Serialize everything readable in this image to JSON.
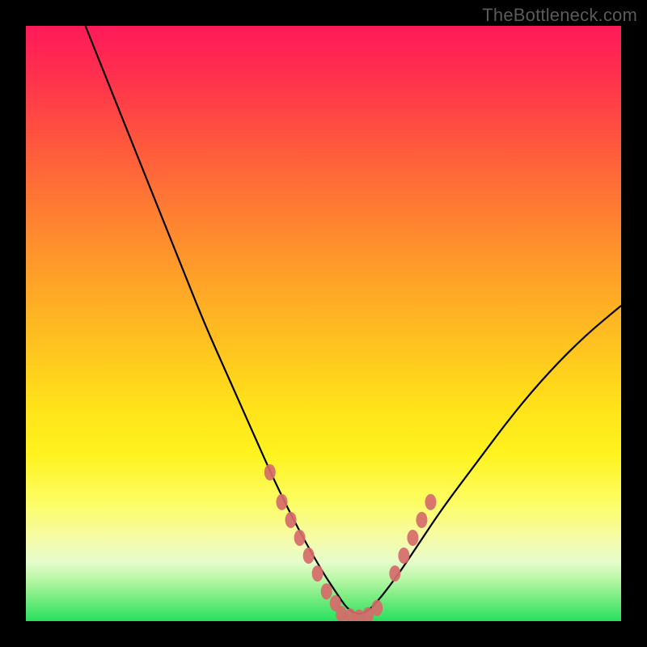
{
  "watermark": "TheBottleneck.com",
  "chart_data": {
    "type": "line",
    "title": "",
    "xlabel": "",
    "ylabel": "",
    "xlim": [
      0,
      100
    ],
    "ylim": [
      0,
      100
    ],
    "grid": false,
    "legend": false,
    "background_gradient": {
      "top": "#ff1a59",
      "mid": "#ffe21a",
      "bottom": "#28e05f"
    },
    "series": [
      {
        "name": "curve",
        "color": "#000000",
        "x": [
          10,
          14,
          18,
          22,
          26,
          30,
          34,
          38,
          42,
          46,
          50,
          52,
          54,
          56,
          58,
          62,
          66,
          70,
          76,
          82,
          88,
          94,
          100
        ],
        "y": [
          100,
          90,
          80,
          70,
          60,
          50,
          41,
          32,
          23,
          15,
          8,
          5,
          2,
          1,
          2,
          7,
          13,
          19,
          27,
          35,
          42,
          48,
          53
        ]
      }
    ],
    "marker_clusters": [
      {
        "name": "left-cluster",
        "color": "#d66a6a",
        "points": [
          {
            "x": 41,
            "y": 25
          },
          {
            "x": 43,
            "y": 20
          },
          {
            "x": 44.5,
            "y": 17
          },
          {
            "x": 46,
            "y": 14
          },
          {
            "x": 47.5,
            "y": 11
          },
          {
            "x": 49,
            "y": 8
          },
          {
            "x": 50.5,
            "y": 5
          },
          {
            "x": 52,
            "y": 3
          }
        ]
      },
      {
        "name": "bottom-cluster",
        "color": "#d66a6a",
        "points": [
          {
            "x": 53,
            "y": 1.2
          },
          {
            "x": 54.5,
            "y": 0.8
          },
          {
            "x": 56,
            "y": 0.6
          },
          {
            "x": 57.5,
            "y": 1.0
          },
          {
            "x": 59,
            "y": 2.2
          }
        ]
      },
      {
        "name": "right-cluster",
        "color": "#d66a6a",
        "points": [
          {
            "x": 62,
            "y": 8
          },
          {
            "x": 63.5,
            "y": 11
          },
          {
            "x": 65,
            "y": 14
          },
          {
            "x": 66.5,
            "y": 17
          },
          {
            "x": 68,
            "y": 20
          }
        ]
      }
    ]
  }
}
